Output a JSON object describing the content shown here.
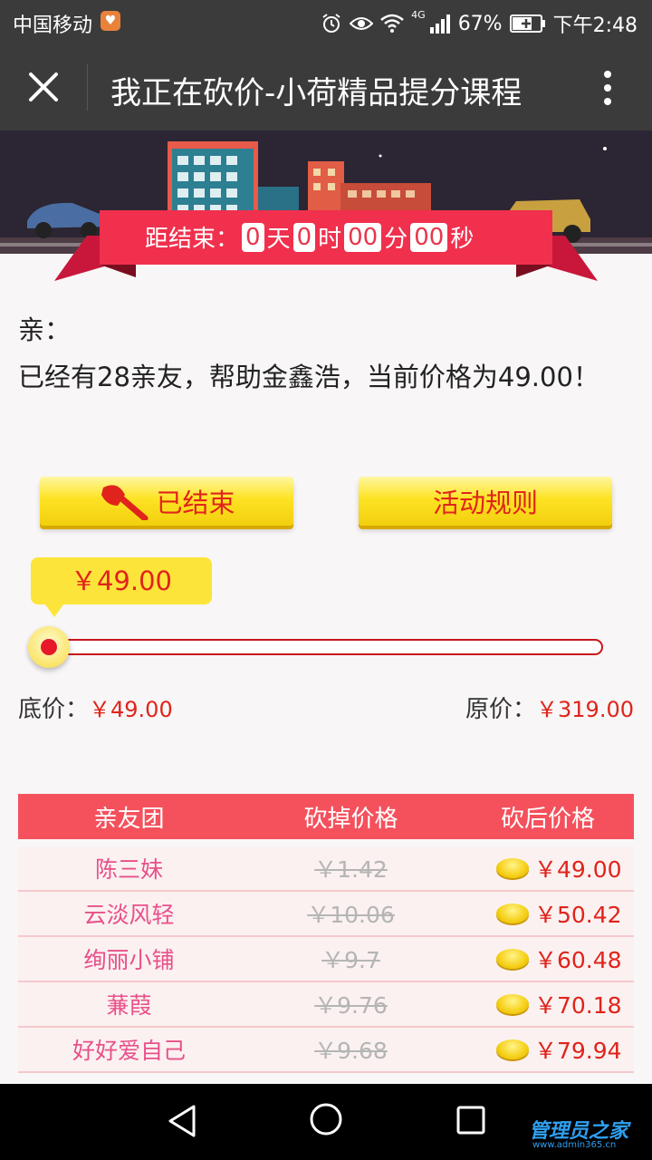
{
  "statusbar": {
    "carrier": "中国移动",
    "network": "4G",
    "battery": "67%",
    "time": "下午2:48"
  },
  "titlebar": {
    "title": "我正在砍价-小荷精品提分课程"
  },
  "countdown": {
    "label": "距结束：",
    "days": "0",
    "days_unit": "天",
    "hours": "0",
    "hours_unit": "时",
    "minutes": "00",
    "minutes_unit": "分",
    "seconds": "00",
    "seconds_unit": "秒"
  },
  "message": {
    "greeting": "亲：",
    "text": "已经有28亲友，帮助金鑫浩，当前价格为49.00！"
  },
  "buttons": {
    "ended": "已结束",
    "rules": "活动规则"
  },
  "price": {
    "current": "￥49.00",
    "progress_fraction": 0.0,
    "floor_label": "底价：",
    "floor_value": "￥49.00",
    "original_label": "原价：",
    "original_value": "￥319.00"
  },
  "table": {
    "headers": [
      "亲友团",
      "砍掉价格",
      "砍后价格"
    ],
    "rows": [
      {
        "name": "陈三妹",
        "cut": "￥1.42",
        "after": "￥49.00"
      },
      {
        "name": "云淡风轻",
        "cut": "￥10.06",
        "after": "￥50.42"
      },
      {
        "name": "绚丽小铺",
        "cut": "￥9.7",
        "after": "￥60.48"
      },
      {
        "name": "蒹葭",
        "cut": "￥9.76",
        "after": "￥70.18"
      },
      {
        "name": "好好爱自己",
        "cut": "￥9.68",
        "after": "￥79.94"
      }
    ]
  },
  "watermark": {
    "brand": "管理员之家",
    "url": "www.admin365.cn"
  },
  "colors": {
    "accent": "#e8364c",
    "button_yellow": "#fde324",
    "table_header": "#f4515d"
  }
}
